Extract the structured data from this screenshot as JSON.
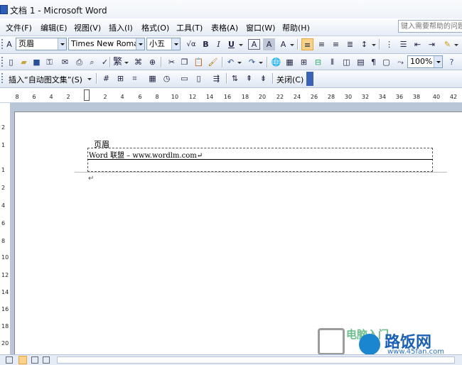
{
  "title": "文档 1 - Microsoft Word",
  "menu": [
    "文件(F)",
    "编辑(E)",
    "视图(V)",
    "插入(I)",
    "格式(O)",
    "工具(T)",
    "表格(A)",
    "窗口(W)",
    "帮助(H)"
  ],
  "help_placeholder": "键入需要帮助的问题",
  "format_toolbar": {
    "style": "页眉",
    "font": "Times New Roman",
    "size": "小五",
    "zoom": "100%"
  },
  "header_footer_toolbar": {
    "insert_autotext": "插入“自动图文集”(S)",
    "close": "关闭(C)"
  },
  "ruler_labels": [
    "8",
    "6",
    "4",
    "2",
    "",
    "2",
    "4",
    "6",
    "8",
    "10",
    "12",
    "14",
    "16",
    "18",
    "20",
    "22",
    "24",
    "26",
    "28",
    "30",
    "32",
    "34",
    "36",
    "38",
    "40",
    "42"
  ],
  "vruler_labels": [
    "2",
    "1",
    "",
    "1",
    "2",
    "4",
    "6",
    "8",
    "10",
    "12",
    "14",
    "16",
    "18",
    "20"
  ],
  "document": {
    "header_label": "页眉",
    "header_text": "Word 联盟 – www.wordlm.com↵",
    "para_mark": "↵"
  },
  "watermark": {
    "text1": "电脑入门",
    "text2": "路饭网",
    "url": "www.45fan.com"
  }
}
